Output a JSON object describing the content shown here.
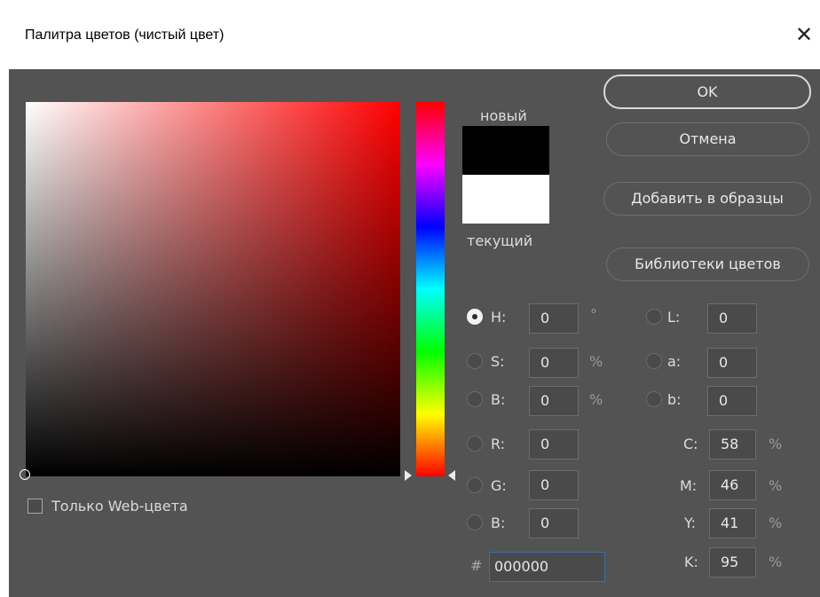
{
  "window": {
    "title": "Палитра цветов (чистый цвет)",
    "close_glyph": "✕"
  },
  "swatch": {
    "new_label": "новый",
    "current_label": "текущий",
    "new_color": "#000000",
    "current_color": "#ffffff"
  },
  "buttons": {
    "ok": "OK",
    "cancel": "Отмена",
    "add_to_swatches": "Добавить в образцы",
    "color_libraries": "Библиотеки цветов"
  },
  "hsb": [
    {
      "label": "H:",
      "value": "0",
      "unit": "°",
      "selected": true
    },
    {
      "label": "S:",
      "value": "0",
      "unit": "%"
    },
    {
      "label": "B:",
      "value": "0",
      "unit": "%"
    }
  ],
  "lab": [
    {
      "label": "L:",
      "value": "0"
    },
    {
      "label": "a:",
      "value": "0"
    },
    {
      "label": "b:",
      "value": "0"
    }
  ],
  "rgb": [
    {
      "label": "R:",
      "value": "0"
    },
    {
      "label": "G:",
      "value": "0"
    },
    {
      "label": "B:",
      "value": "0"
    }
  ],
  "cmyk": [
    {
      "label": "C:",
      "value": "58",
      "unit": "%"
    },
    {
      "label": "M:",
      "value": "46",
      "unit": "%"
    },
    {
      "label": "Y:",
      "value": "41",
      "unit": "%"
    },
    {
      "label": "K:",
      "value": "95",
      "unit": "%"
    }
  ],
  "hex": {
    "label": "#",
    "value": "000000"
  },
  "web_only": {
    "label": "Только Web-цвета",
    "checked": false
  },
  "colors": {
    "dialog_bg": "#535353",
    "accent_field": "#3b6fa6"
  }
}
